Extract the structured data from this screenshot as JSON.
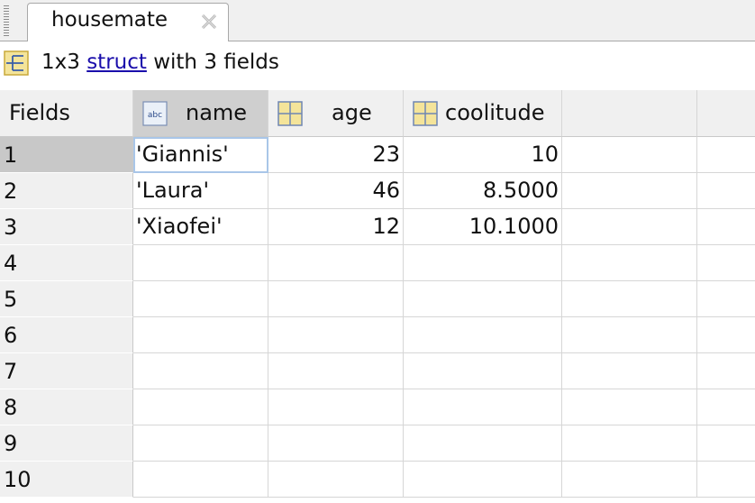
{
  "tab": {
    "title": "housemate",
    "close_icon": "close-icon"
  },
  "info": {
    "prefix": "1x3 ",
    "link": "struct",
    "suffix": " with 3 fields"
  },
  "grid": {
    "corner_label": "Fields",
    "columns": [
      {
        "name": "name",
        "icon": "text-field-icon"
      },
      {
        "name": "age",
        "icon": "numeric-field-icon"
      },
      {
        "name": "coolitude",
        "icon": "numeric-field-icon"
      }
    ],
    "row_numbers": [
      "1",
      "2",
      "3",
      "4",
      "5",
      "6",
      "7",
      "8",
      "9",
      "10"
    ],
    "rows": [
      [
        "'Giannis'",
        "23",
        "10"
      ],
      [
        "'Laura'",
        "46",
        "8.5000"
      ],
      [
        "'Xiaofei'",
        "12",
        "10.1000"
      ]
    ]
  },
  "colors": {
    "selection_header": "#c8c8c8",
    "active_cell_border": "#a9c6e8",
    "link": "#1a0dab"
  }
}
